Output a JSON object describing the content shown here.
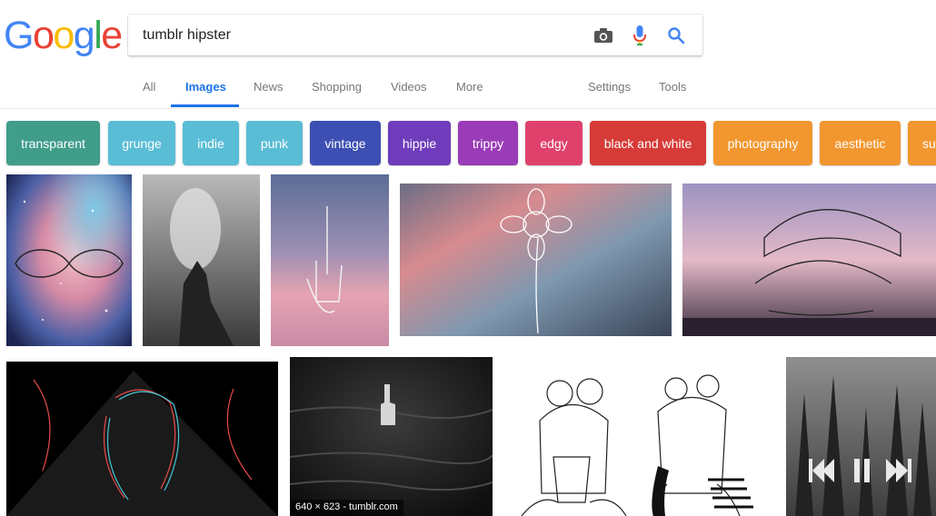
{
  "logo": {
    "letters": [
      "G",
      "o",
      "o",
      "g",
      "l",
      "e"
    ],
    "colors": [
      "#4285F4",
      "#EA4335",
      "#FBBC05",
      "#4285F4",
      "#34A853",
      "#EA4335"
    ]
  },
  "search": {
    "query": "tumblr hipster"
  },
  "icons": {
    "camera": "camera-icon",
    "mic": "microphone-icon",
    "search": "search-icon"
  },
  "tabs": [
    {
      "label": "All"
    },
    {
      "label": "Images",
      "active": true
    },
    {
      "label": "News"
    },
    {
      "label": "Shopping"
    },
    {
      "label": "Videos"
    },
    {
      "label": "More"
    },
    {
      "label": "Settings"
    },
    {
      "label": "Tools"
    }
  ],
  "chips": [
    {
      "label": "transparent",
      "color": "#3f9d8a"
    },
    {
      "label": "grunge",
      "color": "#59bdd6"
    },
    {
      "label": "indie",
      "color": "#59bdd6"
    },
    {
      "label": "punk",
      "color": "#59bdd6"
    },
    {
      "label": "vintage",
      "color": "#3d4fb3"
    },
    {
      "label": "hippie",
      "color": "#6f3dbb"
    },
    {
      "label": "trippy",
      "color": "#9a3bb8"
    },
    {
      "label": "edgy",
      "color": "#e0416c"
    },
    {
      "label": "black and white",
      "color": "#d63b37"
    },
    {
      "label": "photography",
      "color": "#f2962f"
    },
    {
      "label": "aesthetic",
      "color": "#f2962f"
    },
    {
      "label": "su",
      "color": "#f2962f"
    }
  ],
  "results": [
    {
      "caption": ""
    },
    {
      "caption": ""
    },
    {
      "caption": ""
    },
    {
      "caption": ""
    },
    {
      "caption": ""
    },
    {
      "caption": ""
    },
    {
      "caption": "640 × 623 - tumblr.com"
    },
    {
      "caption": ""
    },
    {
      "caption": ""
    }
  ]
}
